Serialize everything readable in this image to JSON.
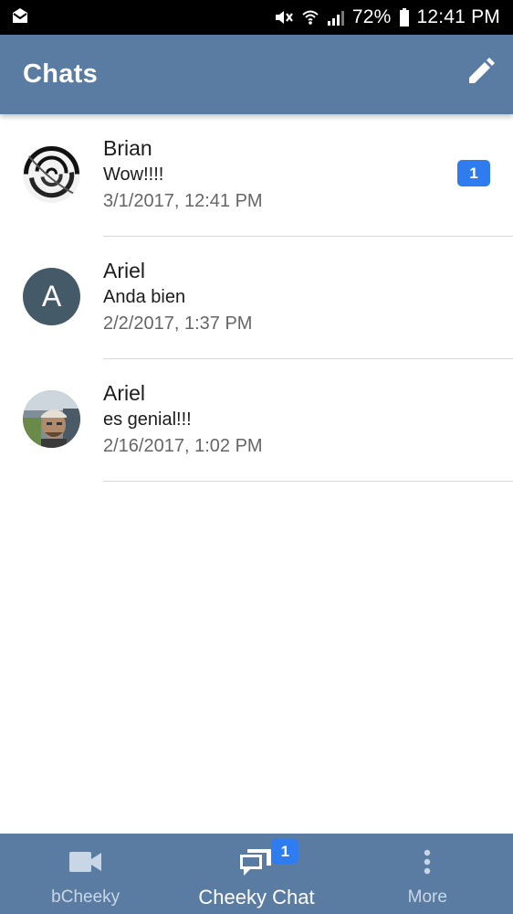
{
  "status_bar": {
    "battery": "72%",
    "time": "12:41 PM",
    "icons": [
      "mail-notification-icon",
      "mute-vibrate-icon",
      "wifi-icon",
      "signal-icon",
      "battery-icon"
    ]
  },
  "app_bar": {
    "title": "Chats",
    "edit_icon": "pencil-icon"
  },
  "chats": [
    {
      "name": "Brian",
      "message": "Wow!!!!",
      "timestamp": "3/1/2017, 12:41 PM",
      "avatar": "swirl-image",
      "unread": "1"
    },
    {
      "name": "Ariel",
      "message": "Anda bien",
      "timestamp": "2/2/2017, 1:37 PM",
      "avatar_letter": "A"
    },
    {
      "name": "Ariel",
      "message": "es genial!!!",
      "timestamp": "2/16/2017, 1:02 PM",
      "avatar": "photo-image"
    }
  ],
  "bottom_nav": {
    "items": [
      {
        "label": "bCheeky",
        "icon": "video-camera-icon"
      },
      {
        "label": "Cheeky Chat",
        "icon": "chat-bubbles-icon",
        "badge": "1",
        "active": true
      },
      {
        "label": "More",
        "icon": "more-vertical-icon"
      }
    ]
  },
  "colors": {
    "primary": "#5a7ca3",
    "badge": "#2f7bf0",
    "avatar_letter_bg": "#455a69"
  }
}
